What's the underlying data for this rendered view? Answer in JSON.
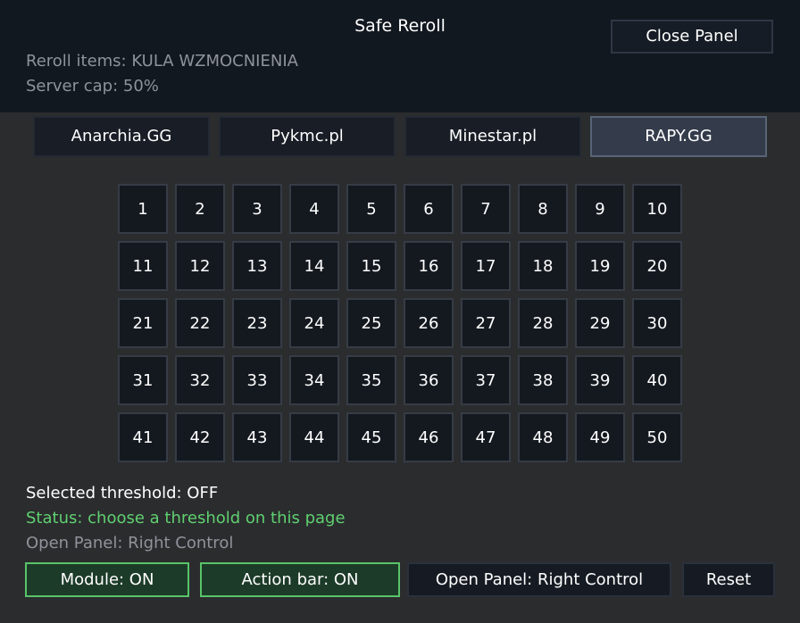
{
  "header": {
    "title": "Safe Reroll",
    "reroll_items": "Reroll items: KULA WZMOCNIENIA",
    "server_cap": "Server cap: 50%",
    "close_label": "Close Panel"
  },
  "servers": [
    {
      "label": "Anarchia.GG",
      "active": false
    },
    {
      "label": "Pykmc.pl",
      "active": false
    },
    {
      "label": "Minestar.pl",
      "active": false
    },
    {
      "label": "RAPY.GG",
      "active": true
    }
  ],
  "thresholds": [
    "1",
    "2",
    "3",
    "4",
    "5",
    "6",
    "7",
    "8",
    "9",
    "10",
    "11",
    "12",
    "13",
    "14",
    "15",
    "16",
    "17",
    "18",
    "19",
    "20",
    "21",
    "22",
    "23",
    "24",
    "25",
    "26",
    "27",
    "28",
    "29",
    "30",
    "31",
    "32",
    "33",
    "34",
    "35",
    "36",
    "37",
    "38",
    "39",
    "40",
    "41",
    "42",
    "43",
    "44",
    "45",
    "46",
    "47",
    "48",
    "49",
    "50"
  ],
  "status": {
    "selected": "Selected threshold: OFF",
    "message": "Status: choose a threshold on this page",
    "open_panel": "Open Panel: Right Control"
  },
  "footer": {
    "module_label": "Module: ON",
    "action_bar_label": "Action bar: ON",
    "open_panel_label": "Open Panel: Right Control",
    "reset_label": "Reset"
  },
  "colors": {
    "background": "#2b2c2e",
    "header": "#121820",
    "status_green": "#5fd070",
    "toggle_on_border": "#58c468",
    "active_tab": "#343c4b"
  }
}
